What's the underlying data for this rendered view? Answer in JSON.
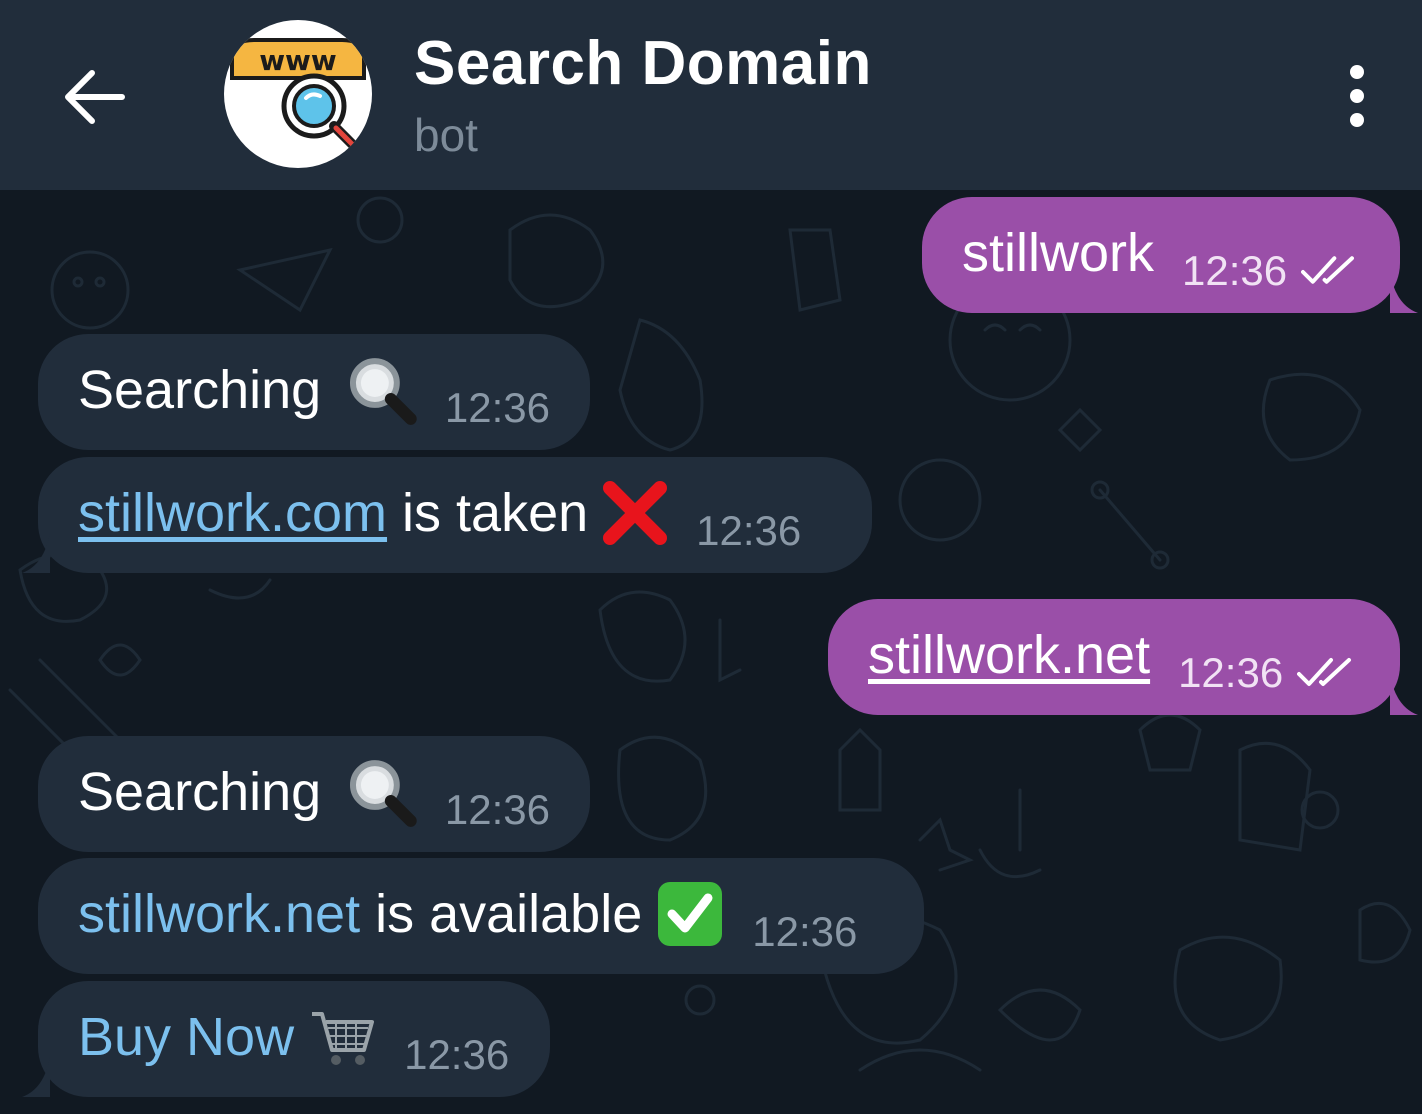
{
  "header": {
    "title": "Search Domain",
    "subtitle": "bot",
    "avatar_text": "www"
  },
  "messages": [
    {
      "direction": "out",
      "text": "stillwork",
      "time": "12:36",
      "status": "read"
    },
    {
      "direction": "in",
      "text": "Searching",
      "emoji": "magnifier-icon",
      "time": "12:36"
    },
    {
      "direction": "in",
      "link": "stillwork.com",
      "text": " is taken",
      "emoji": "cross-mark-icon",
      "time": "12:36"
    },
    {
      "direction": "out",
      "link": "stillwork.net",
      "time": "12:36",
      "status": "read"
    },
    {
      "direction": "in",
      "text": "Searching",
      "emoji": "magnifier-icon",
      "time": "12:36"
    },
    {
      "direction": "in",
      "link": "stillwork.net",
      "text": " is available",
      "emoji": "check-mark-icon",
      "time": "12:36"
    },
    {
      "direction": "in",
      "link": "Buy Now",
      "emoji": "shopping-cart-icon",
      "time": "12:36"
    }
  ],
  "colors": {
    "background": "#111922",
    "header": "#212d3b",
    "incoming_bubble": "#212d3b",
    "outgoing_bubble": "#9a4fa8",
    "link": "#7cc0ee"
  }
}
